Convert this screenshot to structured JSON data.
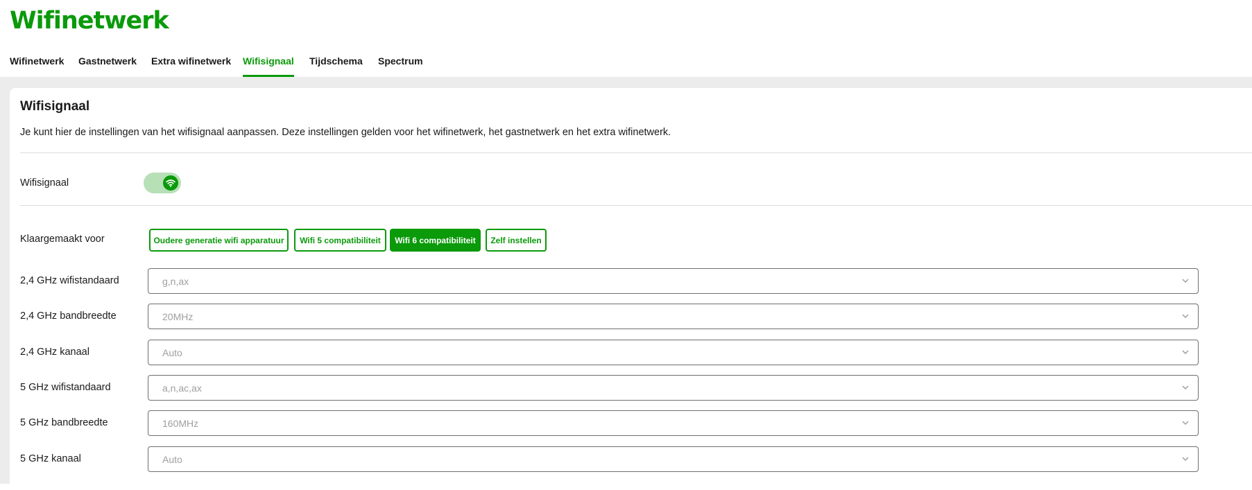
{
  "page_title": "Wifinetwerk",
  "tabs": [
    {
      "label": "Wifinetwerk"
    },
    {
      "label": "Gastnetwerk"
    },
    {
      "label": "Extra wifinetwerk"
    },
    {
      "label": "Wifisignaal",
      "active": true
    },
    {
      "label": "Tijdschema"
    },
    {
      "label": "Spectrum"
    }
  ],
  "card": {
    "title": "Wifisignaal",
    "description": "Je kunt hier de instellingen van het wifisignaal aanpassen. Deze instellingen gelden voor het wifinetwerk, het gastnetwerk en het extra wifinetwerk."
  },
  "wifi_toggle": {
    "label": "Wifisignaal",
    "enabled": true,
    "icon": "wifi-icon"
  },
  "presets": {
    "label": "Klaargemaakt voor",
    "options": [
      {
        "label": "Oudere generatie wifi apparatuur",
        "selected": false
      },
      {
        "label": "Wifi 5 compatibiliteit",
        "selected": false
      },
      {
        "label": "Wifi 6 compatibiliteit",
        "selected": true
      },
      {
        "label": "Zelf instellen",
        "selected": false
      }
    ]
  },
  "settings": [
    {
      "label": "2,4 GHz wifistandaard",
      "value": "g,n,ax"
    },
    {
      "label": "2,4 GHz bandbreedte",
      "value": "20MHz"
    },
    {
      "label": "2,4 GHz kanaal",
      "value": "Auto"
    },
    {
      "label": "5 GHz wifistandaard",
      "value": "a,n,ac,ax"
    },
    {
      "label": "5 GHz bandbreedte",
      "value": "160MHz"
    },
    {
      "label": "5 GHz kanaal",
      "value": "Auto"
    }
  ],
  "colors": {
    "brand_green": "#0a9a0a",
    "toggle_track": "#b7e0b7",
    "background": "#ececec"
  }
}
